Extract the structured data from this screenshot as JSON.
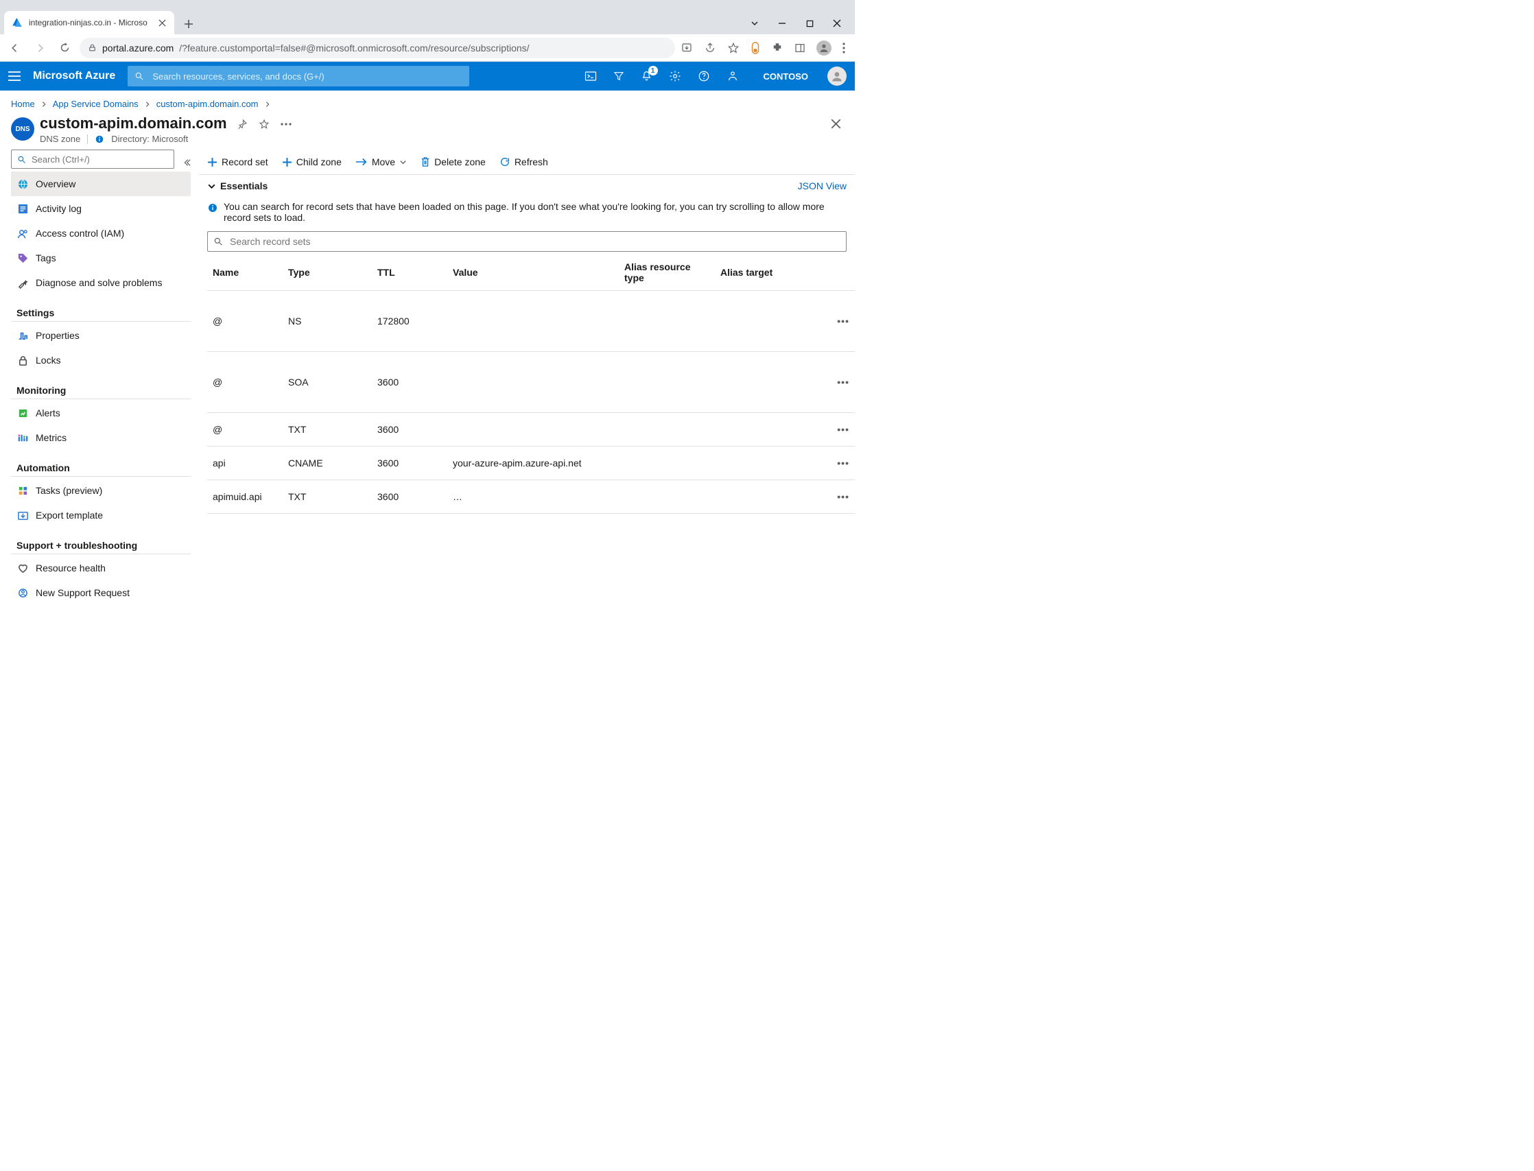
{
  "browser": {
    "tab_title": "integration-ninjas.co.in - Microso",
    "url_host": "portal.azure.com",
    "url_path": "/?feature.customportal=false#@microsoft.onmicrosoft.com/resource/subscriptions/"
  },
  "azure": {
    "brand": "Microsoft Azure",
    "search_placeholder": "Search resources, services, and docs (G+/)",
    "notifications": "1",
    "tenant": "CONTOSO"
  },
  "breadcrumbs": {
    "home": "Home",
    "level1": "App Service Domains",
    "level2": "custom-apim.domain.com"
  },
  "resource": {
    "icon_text": "DNS",
    "title": "custom-apim.domain.com",
    "type": "DNS zone",
    "directory_label": "Directory: Microsoft"
  },
  "sidebar": {
    "search_placeholder": "Search (Ctrl+/)",
    "items_top": [
      {
        "label": "Overview",
        "icon": "globe"
      },
      {
        "label": "Activity log",
        "icon": "log"
      },
      {
        "label": "Access control (IAM)",
        "icon": "people"
      },
      {
        "label": "Tags",
        "icon": "tag"
      },
      {
        "label": "Diagnose and solve problems",
        "icon": "wrench"
      }
    ],
    "section_settings": "Settings",
    "items_settings": [
      {
        "label": "Properties",
        "icon": "props"
      },
      {
        "label": "Locks",
        "icon": "lock"
      }
    ],
    "section_monitoring": "Monitoring",
    "items_monitoring": [
      {
        "label": "Alerts",
        "icon": "alert"
      },
      {
        "label": "Metrics",
        "icon": "metrics"
      }
    ],
    "section_automation": "Automation",
    "items_automation": [
      {
        "label": "Tasks (preview)",
        "icon": "tasks"
      },
      {
        "label": "Export template",
        "icon": "export"
      }
    ],
    "section_support": "Support + troubleshooting",
    "items_support": [
      {
        "label": "Resource health",
        "icon": "heart"
      },
      {
        "label": "New Support Request",
        "icon": "support"
      }
    ]
  },
  "commands": {
    "record_set": "Record set",
    "child_zone": "Child zone",
    "move": "Move",
    "delete_zone": "Delete zone",
    "refresh": "Refresh"
  },
  "essentials": {
    "label": "Essentials",
    "json": "JSON View"
  },
  "info_text": "You can search for record sets that have been loaded on this page. If you don't see what you're looking for, you can try scrolling to allow more record sets to load.",
  "records": {
    "search_placeholder": "Search record sets",
    "headers": {
      "name": "Name",
      "type": "Type",
      "ttl": "TTL",
      "value": "Value",
      "alias_type": "Alias resource type",
      "alias_target": "Alias target"
    },
    "rows": [
      {
        "name": "@",
        "type": "NS",
        "ttl": "172800",
        "value": "",
        "tall": true
      },
      {
        "name": "@",
        "type": "SOA",
        "ttl": "3600",
        "value": "",
        "tall": true
      },
      {
        "name": "@",
        "type": "TXT",
        "ttl": "3600",
        "value": ""
      },
      {
        "name": "api",
        "type": "CNAME",
        "ttl": "3600",
        "value": "your-azure-apim.azure-api.net"
      },
      {
        "name": "apimuid.api",
        "type": "TXT",
        "ttl": "3600",
        "value": "…"
      }
    ]
  }
}
